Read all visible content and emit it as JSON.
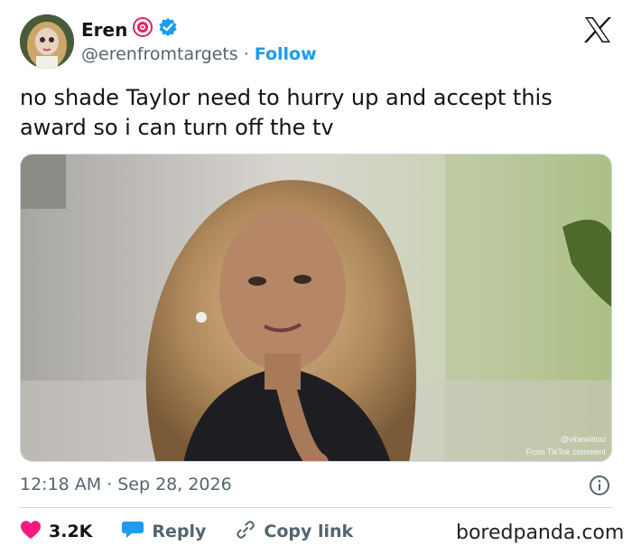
{
  "author": {
    "display_name": "Eren",
    "handle": "@erenfromtargets",
    "separator": "·",
    "follow_label": "Follow",
    "badges": [
      "target-icon",
      "verified-icon"
    ]
  },
  "tweet": {
    "text": "no shade Taylor need to hurry up and accept this award so i can turn off the tv",
    "media_overlay": {
      "line1": "@vibewitioci",
      "line2": "From TikTok comment"
    }
  },
  "meta": {
    "time": "12:18 AM",
    "separator": "·",
    "date": "Sep 28, 2026"
  },
  "actions": {
    "like_count": "3.2K",
    "reply_label": "Reply",
    "copy_link_label": "Copy link"
  },
  "watermark": "boredpanda.com",
  "colors": {
    "accent": "#1d9bf0",
    "like": "#f91880",
    "text": "#0f1419",
    "secondary": "#536471"
  }
}
